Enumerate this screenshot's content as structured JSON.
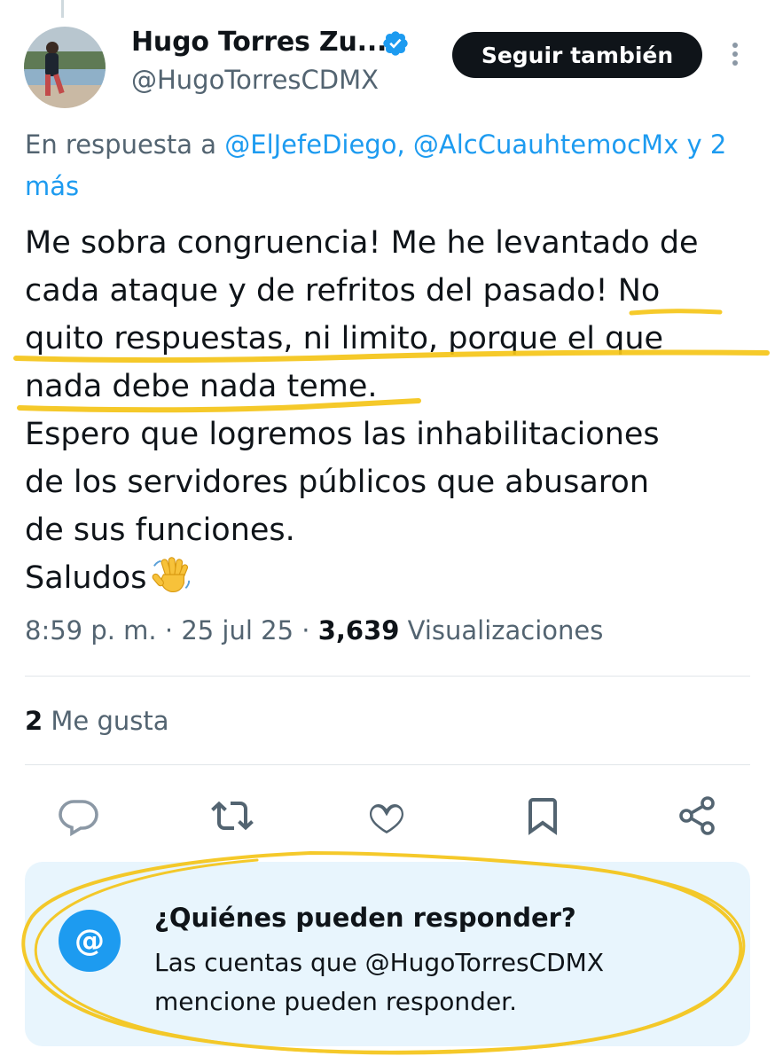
{
  "author": {
    "display_name": "Hugo Torres Zu...",
    "handle": "@HugoTorresCDMX",
    "verified": true
  },
  "follow_button_label": "Seguir también",
  "reply_context": {
    "prefix": "En respuesta a",
    "mention1": "@ElJefeDiego,",
    "mention2": "@AlcCuauhtemocMx",
    "suffix_line1": "y 2",
    "suffix_line2": "más"
  },
  "tweet": {
    "lines": [
      "Me sobra congruencia! Me he levantado de",
      "cada ataque y de refritos del pasado! No",
      "quito respuestas, ni limito, porque el que",
      "nada debe nada teme.",
      "Espero que logremos las inhabilitaciones",
      "de los servidores públicos que abusaron",
      "de sus funciones.",
      "Saludos"
    ],
    "emoji": "waving-hand"
  },
  "meta": {
    "time": "8:59 p. m.",
    "separator": " · ",
    "date": "25 jul 25",
    "views_count": "3,639",
    "views_label": "Visualizaciones"
  },
  "engagement": {
    "likes_count": "2",
    "likes_label": "Me gusta"
  },
  "actions": [
    "reply-icon",
    "retweet-icon",
    "like-icon",
    "bookmark-icon",
    "share-icon"
  ],
  "who_can_reply": {
    "icon": "@",
    "title": "¿Quiénes pueden responder?",
    "body_line1": "Las cuentas que @HugoTorresCDMX",
    "body_line2": "mencione pueden responder."
  },
  "colors": {
    "link_blue": "#1d9bf0",
    "secondary_text": "#536471",
    "highlight_yellow": "#f5c518",
    "reply_box_bg": "#e8f5fd"
  }
}
